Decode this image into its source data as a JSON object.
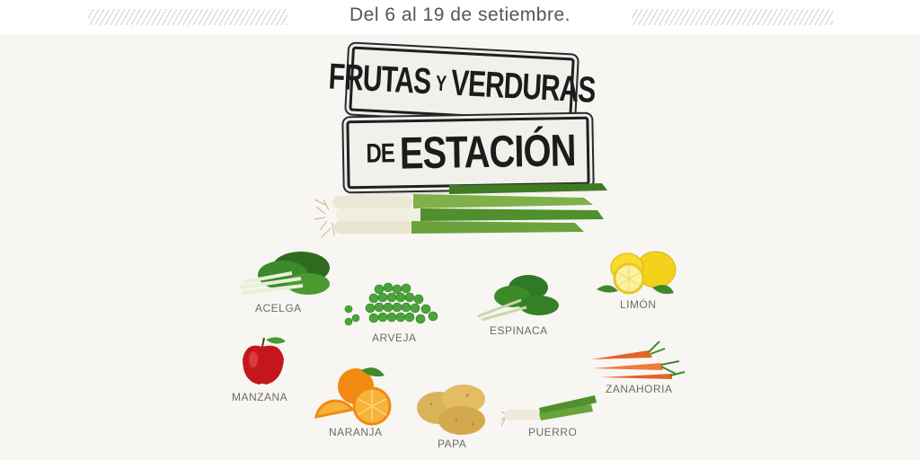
{
  "header": {
    "date_text": "Del 6 al 19 de setiembre."
  },
  "sign": {
    "line1_a": "FRUTAS",
    "line1_b": "Y",
    "line1_c": "VERDURAS",
    "line2_a": "DE",
    "line2_b": "ESTACIÓN"
  },
  "items": {
    "acelga": "ACELGA",
    "arveja": "ARVEJA",
    "espinaca": "ESPINACA",
    "limon": "LIMÓN",
    "manzana": "MANZANA",
    "naranja": "NARANJA",
    "papa": "PAPA",
    "puerro": "PUERRO",
    "zanahoria": "ZANAHORIA"
  },
  "colors": {
    "background": "#f7f6f2",
    "leaf_green": "#3d8a2a",
    "apple_red": "#c4161c",
    "orange": "#f28a12",
    "lemon_yellow": "#f4d21c",
    "potato": "#d9b25a",
    "carrot": "#e8622a"
  }
}
